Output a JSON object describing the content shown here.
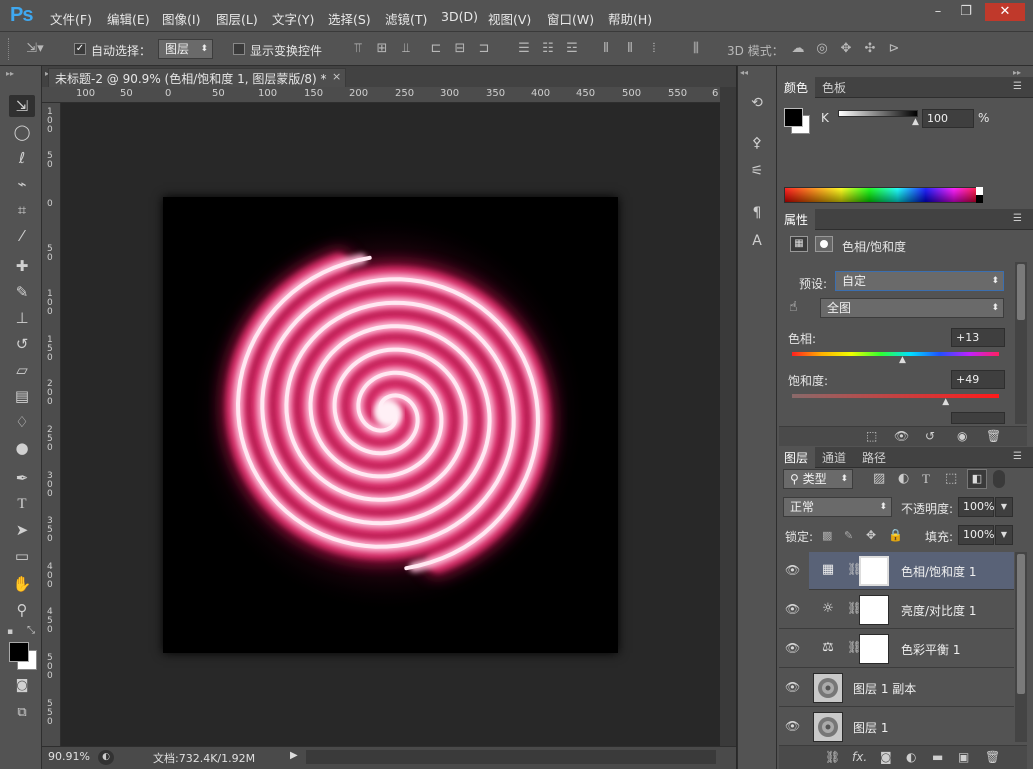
{
  "app": {
    "logo": "Ps"
  },
  "menu": [
    "文件(F)",
    "编辑(E)",
    "图像(I)",
    "图层(L)",
    "文字(Y)",
    "选择(S)",
    "滤镜(T)",
    "3D(D)",
    "视图(V)",
    "窗口(W)",
    "帮助(H)"
  ],
  "window_controls": {
    "minimize": "–",
    "restore": "❐",
    "close": "✕"
  },
  "options": {
    "auto_select_label": "自动选择：",
    "auto_select_checked": "✓",
    "auto_select_target": "图层",
    "show_transform_label": "显示变换控件",
    "mode_3d_label": "3D 模式："
  },
  "document": {
    "tab_title": "未标题-2 @ 90.9% (色相/饱和度 1, 图层蒙版/8) *",
    "close": "×",
    "zoom": "90.91%",
    "doc_info": "文档:732.4K/1.92M",
    "ruler_h": [
      "100",
      "50",
      "0",
      "50",
      "100",
      "150",
      "200",
      "250",
      "300",
      "350",
      "400",
      "450",
      "500",
      "550",
      "6"
    ],
    "ruler_v": [
      "1 0 0",
      "5 0",
      "0",
      "5 0",
      "1 0 0",
      "1 5 0",
      "2 0 0",
      "2 5 0",
      "3 0 0",
      "3 5 0",
      "4 0 0",
      "4 5 0",
      "5 0 0",
      "5 5 0"
    ]
  },
  "color_panel": {
    "tabs": [
      "颜色",
      "色板"
    ],
    "channel_label": "K",
    "channel_value": "100",
    "unit": "%",
    "slider_value": 1.0
  },
  "properties_panel": {
    "tab": "属性",
    "adjustment_title": "色相/饱和度",
    "preset_label": "预设:",
    "preset_value": "自定",
    "range_value": "全图",
    "hue_label": "色相:",
    "hue_value": "+13",
    "hue_position": 0.536,
    "saturation_label": "饱和度:",
    "saturation_value": "+49",
    "saturation_position": 0.745
  },
  "layers_panel": {
    "tabs": [
      "图层",
      "通道",
      "路径"
    ],
    "filter_label": "类型",
    "blend_mode": "正常",
    "opacity_label": "不透明度:",
    "opacity_value": "100%",
    "lock_label": "锁定:",
    "fill_label": "填充:",
    "fill_value": "100%",
    "layers": [
      {
        "name": "色相/饱和度 1",
        "type": "adjustment",
        "icon": "hue-saturation-icon",
        "selected": true
      },
      {
        "name": "亮度/对比度 1",
        "type": "adjustment",
        "icon": "brightness-icon",
        "selected": false
      },
      {
        "name": "色彩平衡 1",
        "type": "adjustment",
        "icon": "color-balance-icon",
        "selected": false
      },
      {
        "name": "图层 1 副本",
        "type": "pixel",
        "icon": "swirl-thumbnail",
        "selected": false
      },
      {
        "name": "图层 1",
        "type": "pixel",
        "icon": "swirl-thumbnail",
        "selected": false
      }
    ]
  },
  "colors": {
    "accent": "#3fa8f0",
    "selected_layer": "#596277",
    "swirl": "#e0306e",
    "swirl_core": "#ffe8f2"
  }
}
